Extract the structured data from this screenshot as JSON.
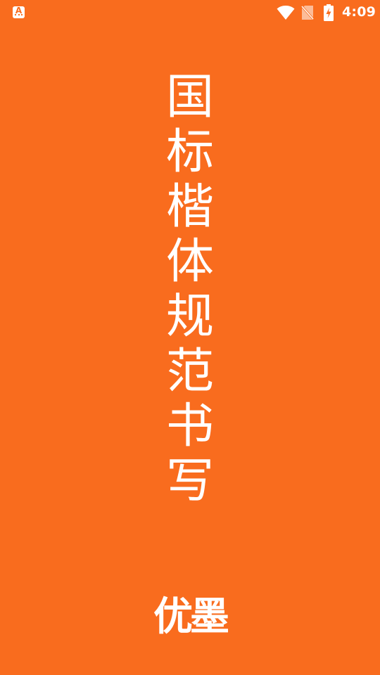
{
  "colors": {
    "background": "#F96C1E",
    "foreground": "#FFFFFF"
  },
  "status_bar": {
    "notification_icon": "app-notification-icon",
    "notification_glyph": "A",
    "icons": [
      "wifi-icon",
      "no-sim-icon",
      "battery-charging-icon"
    ],
    "time": "4:09"
  },
  "splash": {
    "title_chars": [
      "国",
      "标",
      "楷",
      "体",
      "规",
      "范",
      "书",
      "写"
    ],
    "brand": "优墨"
  }
}
